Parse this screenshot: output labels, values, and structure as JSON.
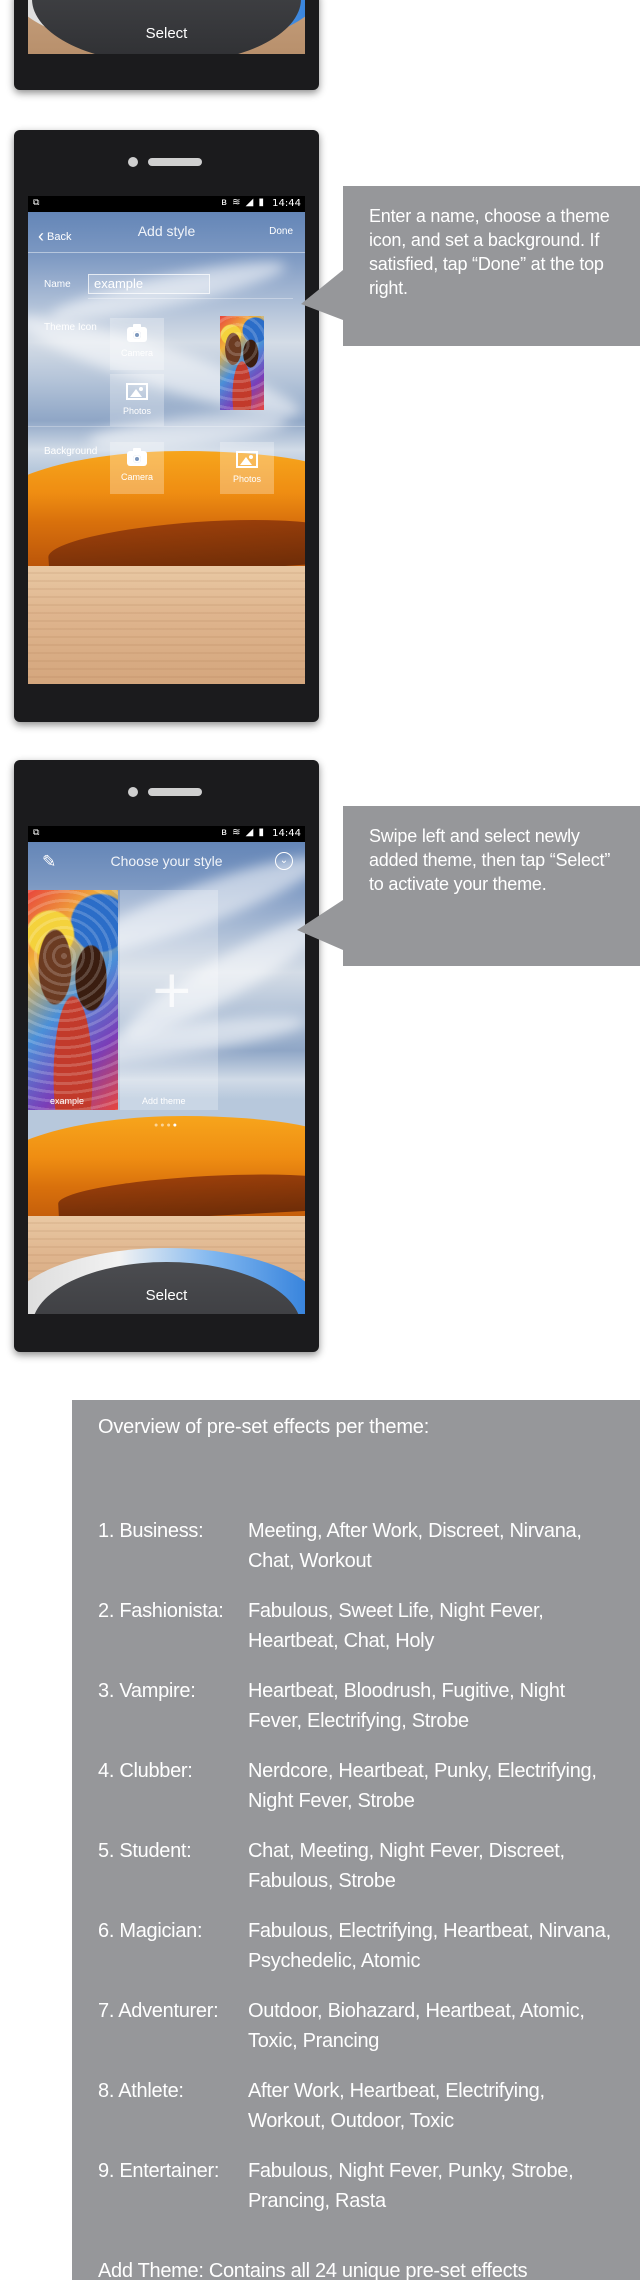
{
  "phone1": {
    "select_label": "Select"
  },
  "phone2": {
    "status_time": "14:44",
    "status_icons": "ʙ ≋ ◢ ▮",
    "back_label": "Back",
    "title": "Add style",
    "done_label": "Done",
    "name_label": "Name",
    "name_value": "example",
    "theme_icon_label": "Theme Icon",
    "theme_tiles": [
      {
        "label": "Camera",
        "icon": "camera-icon"
      },
      {
        "label": "Photos",
        "icon": "photo-icon"
      }
    ],
    "background_label": "Background",
    "background_tiles": [
      {
        "label": "Camera",
        "icon": "camera-icon"
      },
      {
        "label": "Photos",
        "icon": "photo-icon"
      }
    ]
  },
  "callout1": {
    "text": "Enter a name, choose a theme icon, and set a background. If satisfied, tap “Done” at the top right."
  },
  "phone3": {
    "status_time": "14:44",
    "status_icons": "ʙ ≋ ◢ ▮",
    "title": "Choose your style",
    "card_example_label": "example",
    "card_add_label": "Add theme",
    "select_label": "Select"
  },
  "callout2": {
    "text": "Swipe left and select newly added theme, then tap “Select”   to activate your theme."
  },
  "overview": {
    "title": "Overview of pre-set effects per theme:",
    "themes": [
      {
        "name": "1. Business:",
        "effects": "Meeting, After Work, Discreet, Nirvana, Chat, Workout"
      },
      {
        "name": "2. Fashionista:",
        "effects": "Fabulous, Sweet Life, Night Fever, Heartbeat, Chat, Holy"
      },
      {
        "name": "3. Vampire:",
        "effects": "Heartbeat, Bloodrush, Fugitive, Night Fever, Electrifying, Strobe"
      },
      {
        "name": "4. Clubber:",
        "effects": "Nerdcore, Heartbeat, Punky, Electrifying, Night Fever, Strobe"
      },
      {
        "name": "5. Student:",
        "effects": "Chat, Meeting, Night Fever, Discreet, Fabulous, Strobe"
      },
      {
        "name": "6. Magician:",
        "effects": "Fabulous, Electrifying, Heartbeat, Nirvana, Psychedelic, Atomic"
      },
      {
        "name": "7. Adventurer:",
        "effects": "Outdoor, Biohazard, Heartbeat, Atomic, Toxic, Prancing"
      },
      {
        "name": "8. Athlete:",
        "effects": "After Work, Heartbeat, Electrifying, Workout, Outdoor, Toxic"
      },
      {
        "name": "9. Entertainer:",
        "effects": "Fabulous, Night Fever, Punky, Strobe, Prancing, Rasta"
      }
    ],
    "footer": "Add Theme: Contains all 24 unique pre-set effects"
  },
  "colors": {
    "callout_bg": "#96979a",
    "phone_body": "#1b1b1d",
    "select_accent": "#2a7ad9"
  }
}
